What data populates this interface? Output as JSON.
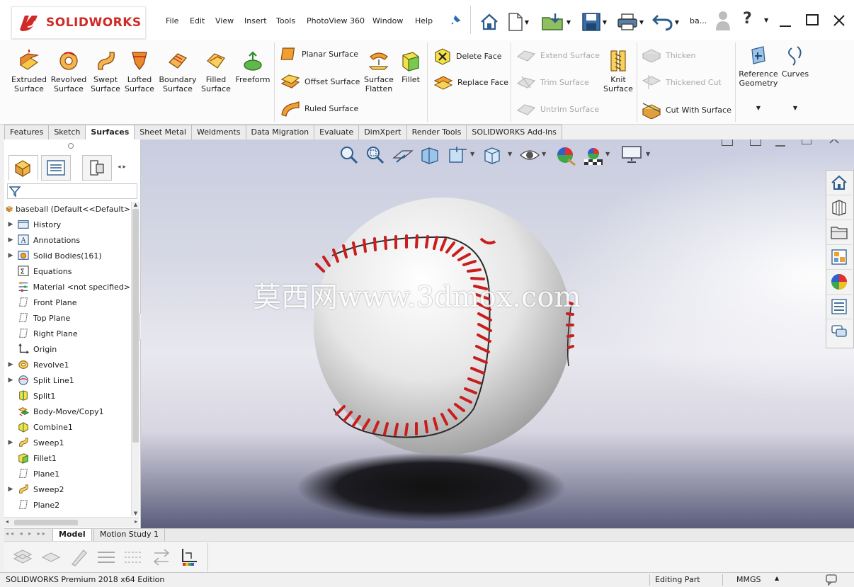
{
  "app": {
    "logo_text": "SOLIDWORKS",
    "doc_abbrev": "ba...",
    "menu": [
      "File",
      "Edit",
      "View",
      "Insert",
      "Tools",
      "PhotoView 360",
      "Window",
      "Help"
    ]
  },
  "ribbon": {
    "large_buttons": [
      {
        "name": "extruded-surface",
        "line1": "Extruded",
        "line2": "Surface"
      },
      {
        "name": "revolved-surface",
        "line1": "Revolved",
        "line2": "Surface"
      },
      {
        "name": "swept-surface",
        "line1": "Swept",
        "line2": "Surface"
      },
      {
        "name": "lofted-surface",
        "line1": "Lofted",
        "line2": "Surface"
      },
      {
        "name": "boundary-surface",
        "line1": "Boundary",
        "line2": "Surface"
      },
      {
        "name": "filled-surface",
        "line1": "Filled",
        "line2": "Surface"
      },
      {
        "name": "freeform",
        "line1": "Freeform",
        "line2": ""
      }
    ],
    "planar_surface": "Planar Surface",
    "offset_surface": "Offset Surface",
    "ruled_surface": "Ruled Surface",
    "surface_flatten_1": "Surface",
    "surface_flatten_2": "Flatten",
    "fillet": "Fillet",
    "delete_face": "Delete Face",
    "replace_face": "Replace Face",
    "extend_surface": "Extend Surface",
    "trim_surface": "Trim Surface",
    "untrim_surface": "Untrim Surface",
    "knit_surface_1": "Knit",
    "knit_surface_2": "Surface",
    "thicken": "Thicken",
    "thickened_cut": "Thickened Cut",
    "cut_with_surface": "Cut With Surface",
    "reference_geometry_1": "Reference",
    "reference_geometry_2": "Geometry",
    "curves": "Curves"
  },
  "tabs": [
    "Features",
    "Sketch",
    "Surfaces",
    "Sheet Metal",
    "Weldments",
    "Data Migration",
    "Evaluate",
    "DimXpert",
    "Render Tools",
    "SOLIDWORKS Add-Ins"
  ],
  "active_tab": "Surfaces",
  "tree": {
    "root": "baseball  (Default<<Default>",
    "items": [
      {
        "label": "History",
        "icon": "history-folder-icon",
        "expand": true
      },
      {
        "label": "Annotations",
        "icon": "annotations-icon",
        "expand": true
      },
      {
        "label": "Solid Bodies(161)",
        "icon": "solid-bodies-icon",
        "expand": true
      },
      {
        "label": "Equations",
        "icon": "equations-icon",
        "expand": false
      },
      {
        "label": "Material <not specified>",
        "icon": "material-icon",
        "expand": false
      },
      {
        "label": "Front Plane",
        "icon": "plane-icon",
        "expand": false
      },
      {
        "label": "Top Plane",
        "icon": "plane-icon",
        "expand": false
      },
      {
        "label": "Right Plane",
        "icon": "plane-icon",
        "expand": false
      },
      {
        "label": "Origin",
        "icon": "origin-icon",
        "expand": false
      },
      {
        "label": "Revolve1",
        "icon": "revolve-icon",
        "expand": true
      },
      {
        "label": "Split Line1",
        "icon": "split-line-icon",
        "expand": true
      },
      {
        "label": "Split1",
        "icon": "split-icon",
        "expand": false
      },
      {
        "label": "Body-Move/Copy1",
        "icon": "move-copy-icon",
        "expand": false
      },
      {
        "label": "Combine1",
        "icon": "combine-icon",
        "expand": false
      },
      {
        "label": "Sweep1",
        "icon": "sweep-icon",
        "expand": true
      },
      {
        "label": "Fillet1",
        "icon": "fillet-icon",
        "expand": false
      },
      {
        "label": "Plane1",
        "icon": "plane-icon",
        "expand": false
      },
      {
        "label": "Sweep2",
        "icon": "sweep-icon",
        "expand": true
      },
      {
        "label": "Plane2",
        "icon": "plane-icon",
        "expand": false
      }
    ]
  },
  "viewport": {
    "watermark": "莫西网www.3dmox.com"
  },
  "bottom_tabs": [
    "Model",
    "Motion Study 1"
  ],
  "status": {
    "left": "SOLIDWORKS Premium 2018 x64 Edition",
    "mode": "Editing Part",
    "units": "MMGS"
  },
  "colors": {
    "brand_red": "#d02a26",
    "stitch_red": "#c81e1e"
  }
}
